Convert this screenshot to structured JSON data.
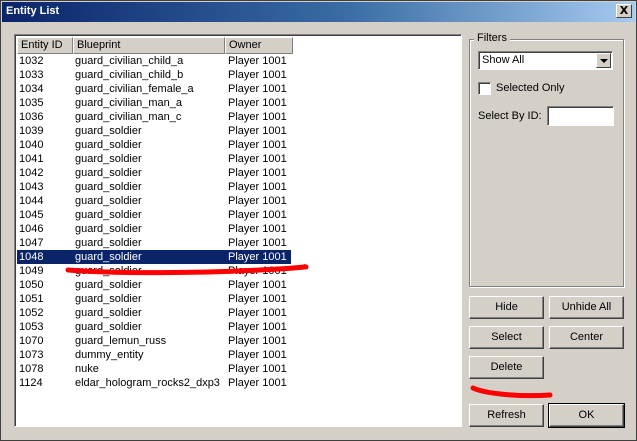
{
  "window": {
    "title": "Entity List",
    "close_glyph": "X"
  },
  "list": {
    "columns": [
      "Entity ID",
      "Blueprint",
      "Owner"
    ],
    "rows": [
      {
        "id": "1032",
        "blueprint": "guard_civilian_child_a",
        "owner": "Player 1001"
      },
      {
        "id": "1033",
        "blueprint": "guard_civilian_child_b",
        "owner": "Player 1001"
      },
      {
        "id": "1034",
        "blueprint": "guard_civilian_female_a",
        "owner": "Player 1001"
      },
      {
        "id": "1035",
        "blueprint": "guard_civilian_man_a",
        "owner": "Player 1001"
      },
      {
        "id": "1036",
        "blueprint": "guard_civilian_man_c",
        "owner": "Player 1001"
      },
      {
        "id": "1039",
        "blueprint": "guard_soldier",
        "owner": "Player 1001"
      },
      {
        "id": "1040",
        "blueprint": "guard_soldier",
        "owner": "Player 1001"
      },
      {
        "id": "1041",
        "blueprint": "guard_soldier",
        "owner": "Player 1001"
      },
      {
        "id": "1042",
        "blueprint": "guard_soldier",
        "owner": "Player 1001"
      },
      {
        "id": "1043",
        "blueprint": "guard_soldier",
        "owner": "Player 1001"
      },
      {
        "id": "1044",
        "blueprint": "guard_soldier",
        "owner": "Player 1001"
      },
      {
        "id": "1045",
        "blueprint": "guard_soldier",
        "owner": "Player 1001"
      },
      {
        "id": "1046",
        "blueprint": "guard_soldier",
        "owner": "Player 1001"
      },
      {
        "id": "1047",
        "blueprint": "guard_soldier",
        "owner": "Player 1001"
      },
      {
        "id": "1048",
        "blueprint": "guard_soldier",
        "owner": "Player 1001",
        "selected": true
      },
      {
        "id": "1049",
        "blueprint": "guard_soldier",
        "owner": "Player 1001"
      },
      {
        "id": "1050",
        "blueprint": "guard_soldier",
        "owner": "Player 1001"
      },
      {
        "id": "1051",
        "blueprint": "guard_soldier",
        "owner": "Player 1001"
      },
      {
        "id": "1052",
        "blueprint": "guard_soldier",
        "owner": "Player 1001"
      },
      {
        "id": "1053",
        "blueprint": "guard_soldier",
        "owner": "Player 1001"
      },
      {
        "id": "1070",
        "blueprint": "guard_lemun_russ",
        "owner": "Player 1001"
      },
      {
        "id": "1073",
        "blueprint": "dummy_entity",
        "owner": "Player 1001"
      },
      {
        "id": "1078",
        "blueprint": "nuke",
        "owner": "Player 1001"
      },
      {
        "id": "1124",
        "blueprint": "eldar_hologram_rocks2_dxp3",
        "owner": "Player 1001"
      }
    ]
  },
  "filters": {
    "title": "Filters",
    "show_select": {
      "value": "Show All"
    },
    "selected_only_label": "Selected Only",
    "select_by_id_label": "Select By ID:",
    "select_by_id_value": ""
  },
  "buttons": {
    "hide": "Hide",
    "unhide_all": "Unhide All",
    "select": "Select",
    "center": "Center",
    "delete": "Delete",
    "refresh": "Refresh",
    "ok": "OK"
  },
  "colors": {
    "selection": "#0a246a",
    "annotation": "#ff0000"
  }
}
